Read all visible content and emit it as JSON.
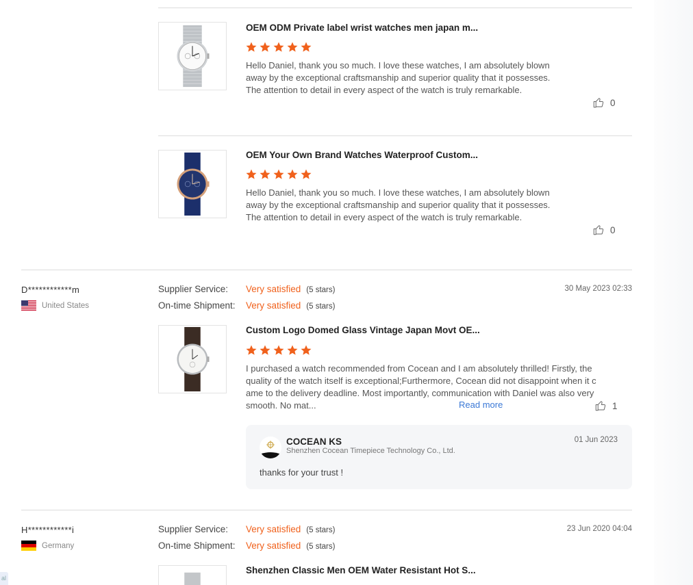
{
  "colors": {
    "accent": "#f0611c",
    "link": "#3a78d6",
    "star": "#f0611c"
  },
  "side_tab": {
    "text": "al"
  },
  "review_group_1": {
    "items": [
      {
        "title": "OEM ODM Private label wrist watches men japan m...",
        "rating": 5,
        "text": "Hello Daniel, thank you so much. I love these watches, I am absolutely blown away by the exceptional craftsmanship and superior quality that it possesses. The attention to detail in every aspect of the watch is truly remarkable.",
        "likes": "0",
        "image_icon": "silver-mesh-watch-icon"
      },
      {
        "title": "OEM Your Own Brand Watches Waterproof Custom...",
        "rating": 5,
        "text": "Hello Daniel, thank you so much. I love these watches, I am absolutely blown away by the exceptional craftsmanship and superior quality that it possesses. The attention to detail in every aspect of the watch is truly remarkable.",
        "likes": "0",
        "image_icon": "blue-leather-watch-icon"
      }
    ]
  },
  "review_2": {
    "user": "D************m",
    "country": "United States",
    "flag_icon": "us-flag-icon",
    "date": "30 May 2023 02:33",
    "supplier_service_label": "Supplier Service:",
    "supplier_service_value": "Very satisfied",
    "supplier_service_count": "(5 stars)",
    "shipment_label": "On-time Shipment:",
    "shipment_value": "Very satisfied",
    "shipment_count": "(5 stars)",
    "product_title": "Custom Logo Domed Glass Vintage Japan Movt OE...",
    "rating": 5,
    "text": "I purchased a watch recommended from Cocean and I am absolutely thrilled! Firstly, the quality of the watch itself is exceptional;Furthermore, Cocean did not disappoint when it came to the delivery deadline. Most importantly, communication with Daniel was also very smooth. No mat...",
    "read_more": "Read more",
    "likes": "1",
    "reply": {
      "name": "COCEAN KS",
      "company": "Shenzhen Cocean Timepiece Technology Co., Ltd.",
      "date": "01 Jun 2023",
      "message": "thanks for your trust !"
    }
  },
  "review_3": {
    "user": "H************i",
    "country": "Germany",
    "flag_icon": "germany-flag-icon",
    "date": "23 Jun 2020 04:04",
    "supplier_service_label": "Supplier Service:",
    "supplier_service_value": "Very satisfied",
    "supplier_service_count": "(5 stars)",
    "shipment_label": "On-time Shipment:",
    "shipment_value": "Very satisfied",
    "shipment_count": "(5 stars)",
    "product_title": "Shenzhen Classic Men OEM Water Resistant Hot S..."
  }
}
